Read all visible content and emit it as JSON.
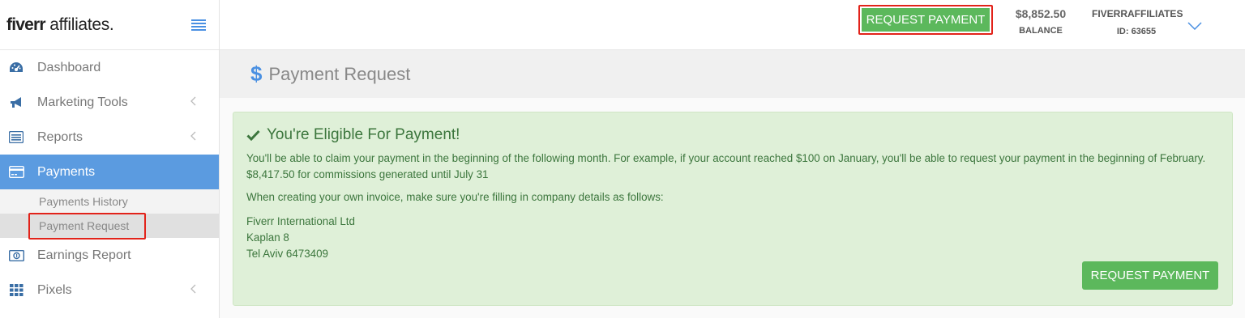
{
  "logo": {
    "brand": "fiverr",
    "suffix": " affiliates."
  },
  "sidebar": {
    "items": [
      {
        "label": "Dashboard",
        "icon": "dashboard-icon"
      },
      {
        "label": "Marketing Tools",
        "icon": "megaphone-icon"
      },
      {
        "label": "Reports",
        "icon": "list-icon"
      },
      {
        "label": "Payments",
        "icon": "credit-card-icon"
      },
      {
        "label": "Earnings Report",
        "icon": "money-icon"
      },
      {
        "label": "Pixels",
        "icon": "grid-icon"
      }
    ],
    "payments_sub": [
      {
        "label": "Payments History"
      },
      {
        "label": "Payment Request"
      }
    ]
  },
  "topbar": {
    "request_label": "REQUEST PAYMENT",
    "balance_amount": "$8,852.50",
    "balance_caption": "BALANCE",
    "account_name": "FIVERRAFFILIATES",
    "account_id": "ID: 63655"
  },
  "page": {
    "title": "Payment Request"
  },
  "alert": {
    "heading": "You're Eligible For Payment!",
    "p1": "You'll be able to claim your payment in the beginning of the following month. For example, if your account reached $100 on January, you'll be able to request your payment in the beginning of February. $8,417.50 for commissions generated until July 31",
    "p2": "When creating your own invoice, make sure you're filling in company details as follows:",
    "address": [
      "Fiverr International Ltd",
      "Kaplan 8",
      "Tel Aviv 6473409"
    ],
    "button_label": "REQUEST PAYMENT"
  },
  "colors": {
    "accent": "#5b9be0",
    "success": "#5cb85c",
    "alert_bg": "#dff0d8",
    "alert_text": "#3c763d",
    "highlight": "#e2231a"
  }
}
